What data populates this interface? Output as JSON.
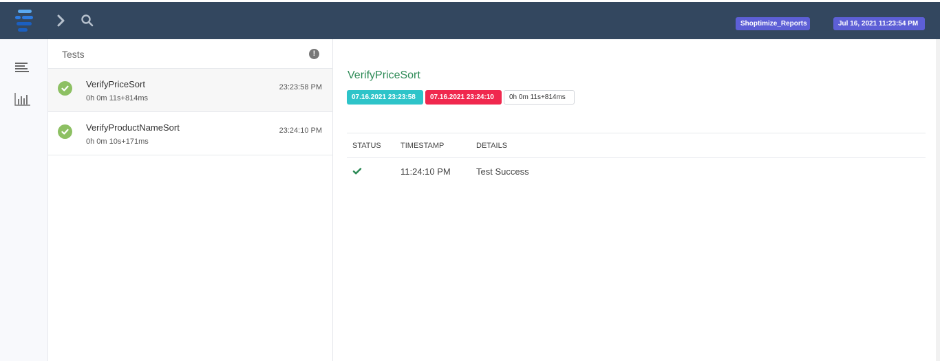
{
  "header": {
    "report_badge": "Shoptimize_Reports",
    "date_badge": "Jul 16, 2021 11:23:54 PM",
    "badge_color": "#5d5fd6"
  },
  "sidebar": {
    "items": [
      {
        "icon": "list-icon"
      },
      {
        "icon": "bar-chart-icon"
      }
    ]
  },
  "test_list": {
    "title": "Tests",
    "items": [
      {
        "name": "VerifyPriceSort",
        "duration": "0h 0m 11s+814ms",
        "time": "23:23:58 PM",
        "status": "pass"
      },
      {
        "name": "VerifyProductNameSort",
        "duration": "0h 0m 10s+171ms",
        "time": "23:24:10 PM",
        "status": "pass"
      }
    ]
  },
  "detail": {
    "title": "VerifyPriceSort",
    "start_tag": "07.16.2021 23:23:58",
    "end_tag": "07.16.2021 23:24:10",
    "duration_tag": "0h 0m 11s+814ms",
    "table": {
      "headers": [
        "STATUS",
        "TIMESTAMP",
        "DETAILS"
      ],
      "rows": [
        {
          "status": "pass",
          "timestamp": "11:24:10 PM",
          "details": "Test Success"
        }
      ]
    }
  },
  "colors": {
    "topbar": "#33475f",
    "pass": "#8dc063",
    "title_green": "#2e8b57",
    "start_tag": "#2ec4c9",
    "end_tag": "#f0284e"
  }
}
